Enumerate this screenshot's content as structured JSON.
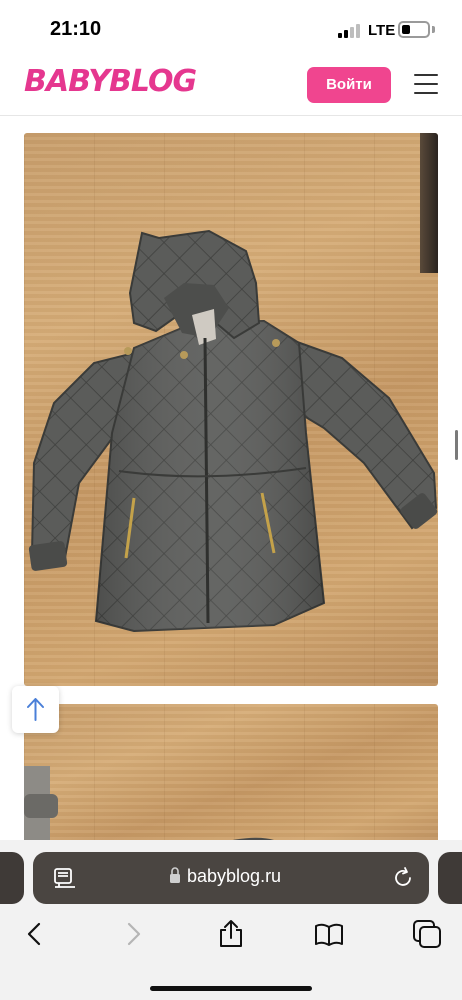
{
  "status_bar": {
    "time": "21:10",
    "network": "LTE",
    "signal_icon": "cellular-signal-icon",
    "battery_icon": "battery-icon"
  },
  "header": {
    "logo_text": "BABYBLOG",
    "login_label": "Войти",
    "menu_icon": "hamburger-menu-icon",
    "brand_color": "#e5378f",
    "button_color": "#f0458f"
  },
  "content": {
    "scroll_up_icon": "arrow-up-icon"
  },
  "browser": {
    "url": "babyblog.ru",
    "reader_icon": "reader-mode-icon",
    "lock_icon": "lock-icon",
    "reload_icon": "reload-icon",
    "toolbar": [
      "back-icon",
      "forward-icon",
      "share-icon",
      "bookmarks-icon",
      "tabs-icon"
    ]
  }
}
